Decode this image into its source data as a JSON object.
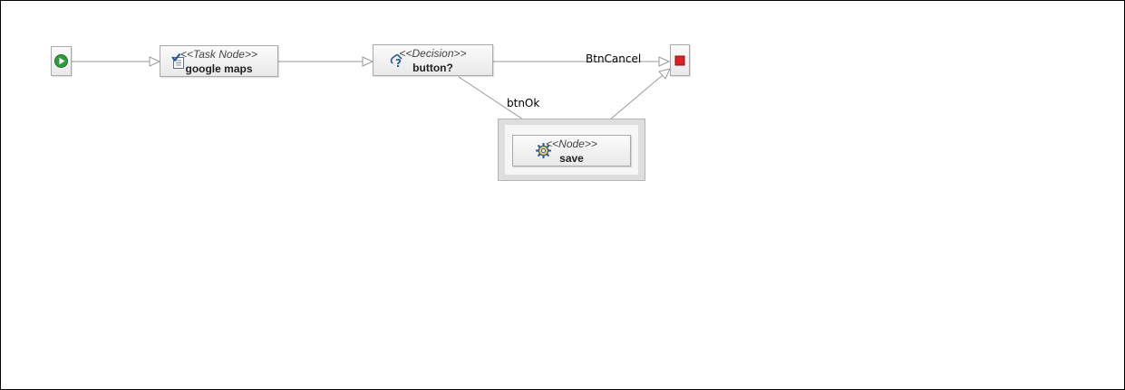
{
  "diagram": {
    "nodes": {
      "start": {
        "kind": "start",
        "icon": "play-icon",
        "color": "#2e9e3c"
      },
      "google_maps": {
        "stereotype": "<<Task Node>>",
        "name": "google maps",
        "icon": "task-checklist-icon"
      },
      "decision": {
        "stereotype": "<<Decision>>",
        "name": "button?",
        "icon": "decision-question-icon"
      },
      "end": {
        "kind": "end",
        "icon": "stop-icon",
        "color": "#e02020"
      },
      "save": {
        "stereotype": "<<Node>>",
        "name": "save",
        "icon": "gear-icon"
      }
    },
    "edges": [
      {
        "from": "start",
        "to": "google_maps",
        "label": ""
      },
      {
        "from": "google_maps",
        "to": "decision",
        "label": ""
      },
      {
        "from": "decision",
        "to": "end",
        "label": "BtnCancel"
      },
      {
        "from": "decision",
        "to": "save",
        "label": "btnOk"
      },
      {
        "from": "save",
        "to": "end",
        "label": ""
      }
    ],
    "edge_color": "#9a9a9a"
  }
}
